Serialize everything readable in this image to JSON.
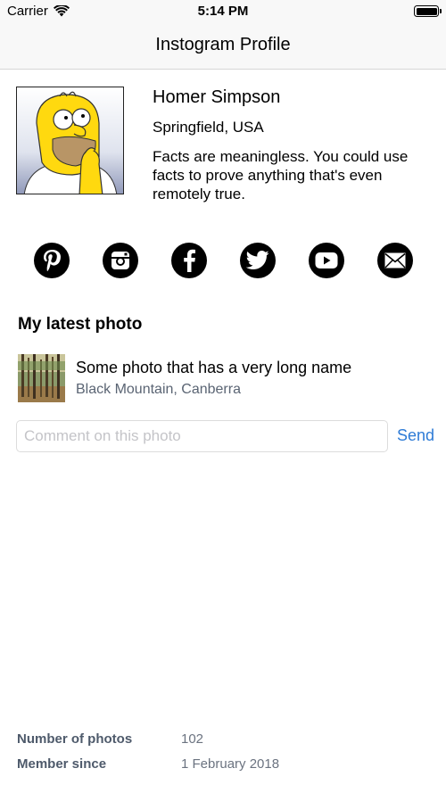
{
  "status_bar": {
    "carrier": "Carrier",
    "time": "5:14 PM",
    "icons": [
      "wifi-icon",
      "battery-icon"
    ]
  },
  "nav": {
    "title": "Instogram Profile"
  },
  "profile": {
    "name": "Homer Simpson",
    "location": "Springfield, USA",
    "bio": "Facts are meaningless. You could use facts to prove anything that's even remotely true."
  },
  "social": {
    "icons": [
      "pinterest-icon",
      "instagram-icon",
      "facebook-icon",
      "twitter-icon",
      "youtube-icon",
      "mail-icon"
    ]
  },
  "latest_photo": {
    "section_title": "My latest photo",
    "name": "Some photo that has a very long name",
    "location": "Black Mountain, Canberra"
  },
  "comment": {
    "placeholder": "Comment on this photo",
    "value": "",
    "send_label": "Send"
  },
  "stats": {
    "photos_label": "Number of photos",
    "photos_value": "102",
    "member_label": "Member since",
    "member_value": "1 February 2018"
  },
  "colors": {
    "accent": "#2e7bd6",
    "secondary_text": "#5a6473",
    "nav_background": "#f8f8f8"
  }
}
